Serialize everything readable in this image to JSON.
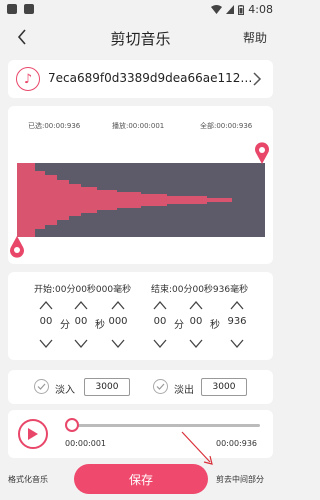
{
  "statusbar": {
    "time": "4:08"
  },
  "header": {
    "title": "剪切音乐",
    "help": "帮助"
  },
  "file": {
    "name": "7eca689f0d3389d9dea66ae112e5..."
  },
  "waveform_info": {
    "selected": "已选:00:00:936",
    "playing": "播放:00:00:001",
    "total": "全部:00:00:936"
  },
  "time_editor": {
    "start_label": "开始:00分00秒000毫秒",
    "end_label": "结束:00分00秒936毫秒",
    "start": {
      "min": "00",
      "sec": "00",
      "ms": "000"
    },
    "end": {
      "min": "00",
      "sec": "00",
      "ms": "936"
    },
    "unit_min": "分",
    "unit_sec": "秒"
  },
  "fade": {
    "fade_in_label": "淡入",
    "fade_in_value": "3000",
    "fade_out_label": "淡出",
    "fade_out_value": "3000"
  },
  "player": {
    "current": "00:00:001",
    "total": "00:00:936",
    "progress": 0.0
  },
  "bottom": {
    "format_label": "格式化音乐",
    "save_label": "保存",
    "cut_middle_label": "剪去中间部分"
  },
  "colors": {
    "accent": "#e9476a",
    "wave_bg": "#5d5a6a",
    "wave_fg": "#d9546f"
  }
}
